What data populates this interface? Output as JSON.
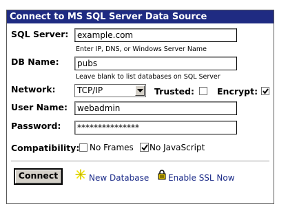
{
  "window": {
    "title": "Connect to MS SQL Server Data Source"
  },
  "fields": {
    "sql_server": {
      "label": "SQL Server:",
      "value": "example.com",
      "hint": "Enter IP, DNS, or Windows Server Name"
    },
    "db_name": {
      "label": "DB Name:",
      "value": "pubs",
      "hint": "Leave blank to list databases on SQL Server"
    },
    "network": {
      "label": "Network:",
      "selected": "TCP/IP"
    },
    "trusted": {
      "label": "Trusted:",
      "checked": false
    },
    "encrypt": {
      "label": "Encrypt:",
      "checked": true
    },
    "user_name": {
      "label": "User Name:",
      "value": "webadmin"
    },
    "password": {
      "label": "Password:",
      "value": "***************"
    }
  },
  "compatibility": {
    "label": "Compatibility:",
    "no_frames": {
      "label": "No Frames",
      "checked": false
    },
    "no_javascript": {
      "label": "No JavaScript",
      "checked": true
    }
  },
  "actions": {
    "connect_label": "Connect",
    "new_database_label": "New Database",
    "new_database_icon": "sparkle-icon",
    "enable_ssl_label": "Enable SSL Now",
    "enable_ssl_icon": "padlock-icon"
  },
  "colors": {
    "titlebar_bg": "#1f2b82",
    "link": "#1a2a88",
    "sparkle": "#f2e600",
    "padlock": "#e3c400"
  }
}
